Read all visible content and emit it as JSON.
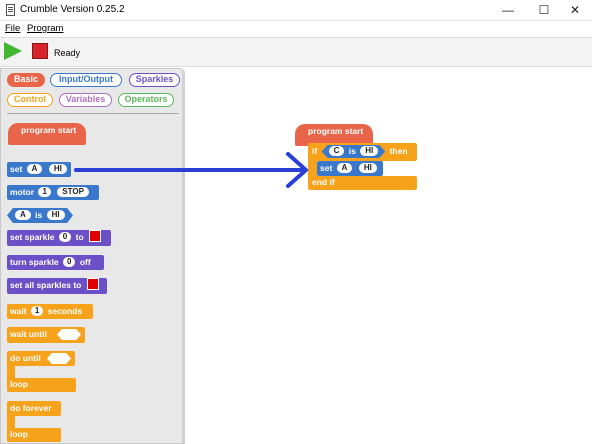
{
  "window": {
    "title": "Crumble Version 0.25.2",
    "minimize": "—",
    "maximize": "☐",
    "close": "✕"
  },
  "menu": {
    "file": "File",
    "program": "Program"
  },
  "toolbar": {
    "status": "Ready",
    "play_icon": "play-icon",
    "stop_icon": "stop-icon"
  },
  "palette": {
    "tabs": [
      {
        "label": "Basic",
        "color": "#e8654a",
        "active": true
      },
      {
        "label": "Input/Output",
        "color": "#3a78cc"
      },
      {
        "label": "Sparkles",
        "color": "#6c50c8"
      },
      {
        "label": "Control",
        "color": "#f7a21b"
      },
      {
        "label": "Variables",
        "color": "#b070c0"
      },
      {
        "label": "Operators",
        "color": "#5cb85c"
      }
    ],
    "blocks": {
      "program_start": "program start",
      "set": "set",
      "set_var": "A",
      "set_val": "HI",
      "motor": "motor",
      "motor_num": "1",
      "motor_state": "STOP",
      "is_var": "A",
      "is_word": "is",
      "is_val": "HI",
      "set_sparkle": "set sparkle",
      "set_sparkle_num": "0",
      "set_sparkle_to": "to",
      "turn_sparkle": "turn sparkle",
      "turn_sparkle_num": "0",
      "turn_sparkle_off": "off",
      "set_all_sparkles": "set all sparkles to",
      "wait": "wait",
      "wait_num": "1",
      "wait_unit": "seconds",
      "wait_until": "wait until",
      "do_until": "do until",
      "loop1": "loop",
      "do_forever": "do forever",
      "loop2": "loop"
    }
  },
  "canvas": {
    "program_start": "program start",
    "if": "if",
    "if_var": "C",
    "if_is": "is",
    "if_val": "HI",
    "then": "then",
    "set": "set",
    "set_var": "A",
    "set_val": "HI",
    "end_if": "end if"
  },
  "colors": {
    "sparkle": "#e00000",
    "arrow": "#2a3fd6"
  }
}
